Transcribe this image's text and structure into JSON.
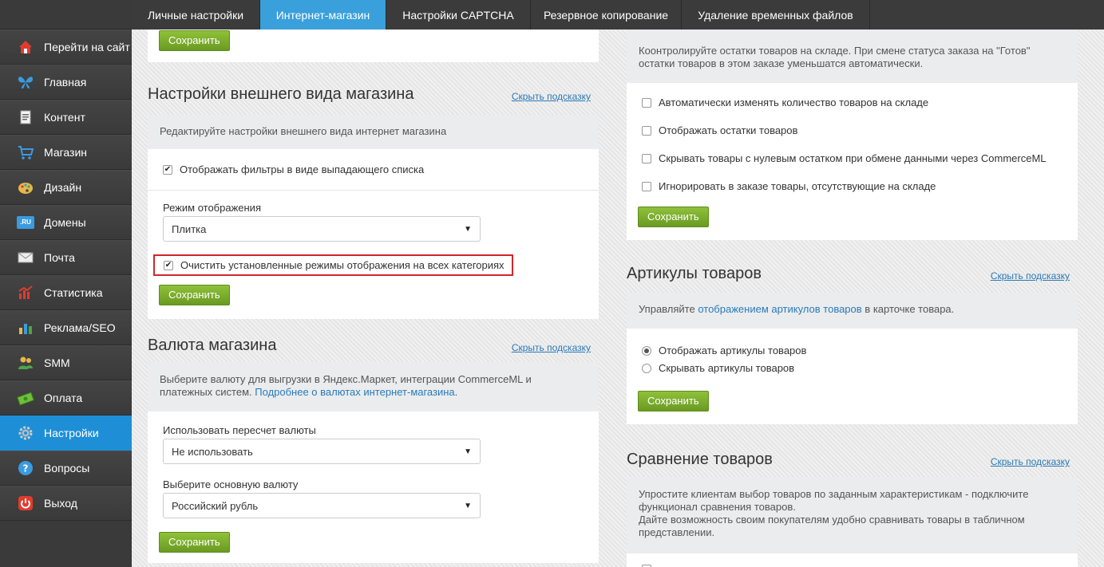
{
  "tabs": [
    {
      "label": "Личные настройки"
    },
    {
      "label": "Интернет-магазин"
    },
    {
      "label": "Настройки CAPTCHA"
    },
    {
      "label": "Резервное копирование"
    },
    {
      "label": "Удаление временных файлов"
    }
  ],
  "sidebar": {
    "items": [
      {
        "label": "Перейти на сайт",
        "icon": "home-icon"
      },
      {
        "label": "Главная",
        "icon": "butterfly-icon"
      },
      {
        "label": "Контент",
        "icon": "document-icon"
      },
      {
        "label": "Магазин",
        "icon": "cart-icon"
      },
      {
        "label": "Дизайн",
        "icon": "palette-icon"
      },
      {
        "label": "Домены",
        "icon": "domain-icon",
        "badge": ".RU"
      },
      {
        "label": "Почта",
        "icon": "mail-icon"
      },
      {
        "label": "Статистика",
        "icon": "chart-icon"
      },
      {
        "label": "Реклама/SEO",
        "icon": "bars-icon"
      },
      {
        "label": "SMM",
        "icon": "people-icon"
      },
      {
        "label": "Оплата",
        "icon": "money-icon"
      },
      {
        "label": "Настройки",
        "icon": "gear-icon"
      },
      {
        "label": "Вопросы",
        "icon": "question-icon"
      },
      {
        "label": "Выход",
        "icon": "power-icon"
      }
    ]
  },
  "save_label": "Сохранить",
  "hide_hint_label": "Скрыть подсказку",
  "appearance": {
    "title": "Настройки внешнего вида магазина",
    "hint": "Редактируйте настройки внешнего вида интернет магазина",
    "filters_dropdown": "Отображать фильтры в виде выпадающего списка",
    "display_mode_label": "Режим отображения",
    "display_mode_value": "Плитка",
    "clear_modes": "Очистить установленные режимы отображения на всех категориях"
  },
  "currency": {
    "title": "Валюта магазина",
    "hint": "Выберите валюту для выгрузки в Яндекс.Маркет, интеграции CommerceML и платежных систем.",
    "hint_link": "Подробнее о валютах интернет-магазина",
    "hint_end": ".",
    "recalc_label": "Использовать пересчет валюты",
    "recalc_value": "Не использовать",
    "main_label": "Выберите основную валюту",
    "main_value": "Российский рубль"
  },
  "stock": {
    "hint_line1": "Коонтролируйте остатки товаров на складе. При смене статуса заказа на \"Готов\"",
    "hint_line2": "остатки товаров в этом заказе уменьшатся автоматически.",
    "options": [
      "Автоматически изменять количество товаров на складе",
      "Отображать остатки товаров",
      "Скрывать товары с нулевым остатком при обмене данными через CommerceML",
      "Игнорировать в заказе товары, отсутствующие на складе"
    ]
  },
  "articles": {
    "title": "Артикулы товаров",
    "hint_start": "Управляйте ",
    "hint_link": "отображением артикулов товаров",
    "hint_end": " в карточке товара.",
    "show": "Отображать артикулы товаров",
    "hide": "Скрывать артикулы товаров"
  },
  "compare": {
    "title": "Сравнение товаров",
    "hint_line1": "Упростите клиентам выбор товаров по заданным характеристикам - подключите",
    "hint_line2": "функционал сравнения товаров.",
    "hint_line3": "Дайте возможность своим покупателям удобно сравнивать товары в табличном",
    "hint_line4": "представлении."
  },
  "colors": {
    "accent": "#3aa0db",
    "sidebar_active": "#1e8fd6",
    "save_green": "#7cad2e",
    "link": "#2a7ab8",
    "highlight": "#d0262b"
  }
}
